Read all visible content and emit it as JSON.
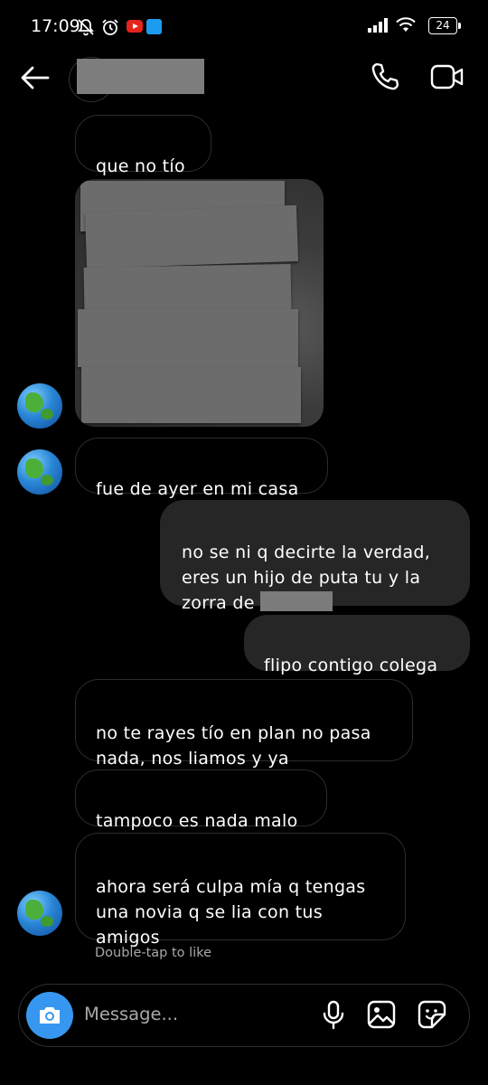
{
  "status_bar": {
    "time": "17:09",
    "battery": "24"
  },
  "header": {
    "back_icon": "arrow-left-icon",
    "call_icon": "phone-icon",
    "video_icon": "video-camera-icon"
  },
  "messages": [
    {
      "text": "que no tío"
    },
    {
      "text": "fue de ayer en mi casa"
    },
    {
      "text": "no se ni q decirte la verdad,\neres un hijo de puta tu y la\nzorra de "
    },
    {
      "text": "flipo contigo colega"
    },
    {
      "text": "no te rayes tío en plan no pasa\nnada, nos liamos y ya"
    },
    {
      "text": "tampoco es nada malo"
    },
    {
      "text": "ahora será culpa mía q tengas\nuna novia q se lia con tus\namigos"
    }
  ],
  "hint": "Double-tap to like",
  "composer": {
    "placeholder": "Message...",
    "icons": [
      "camera-icon",
      "microphone-icon",
      "gallery-icon",
      "sticker-icon"
    ],
    "accent": "#3797f0"
  }
}
